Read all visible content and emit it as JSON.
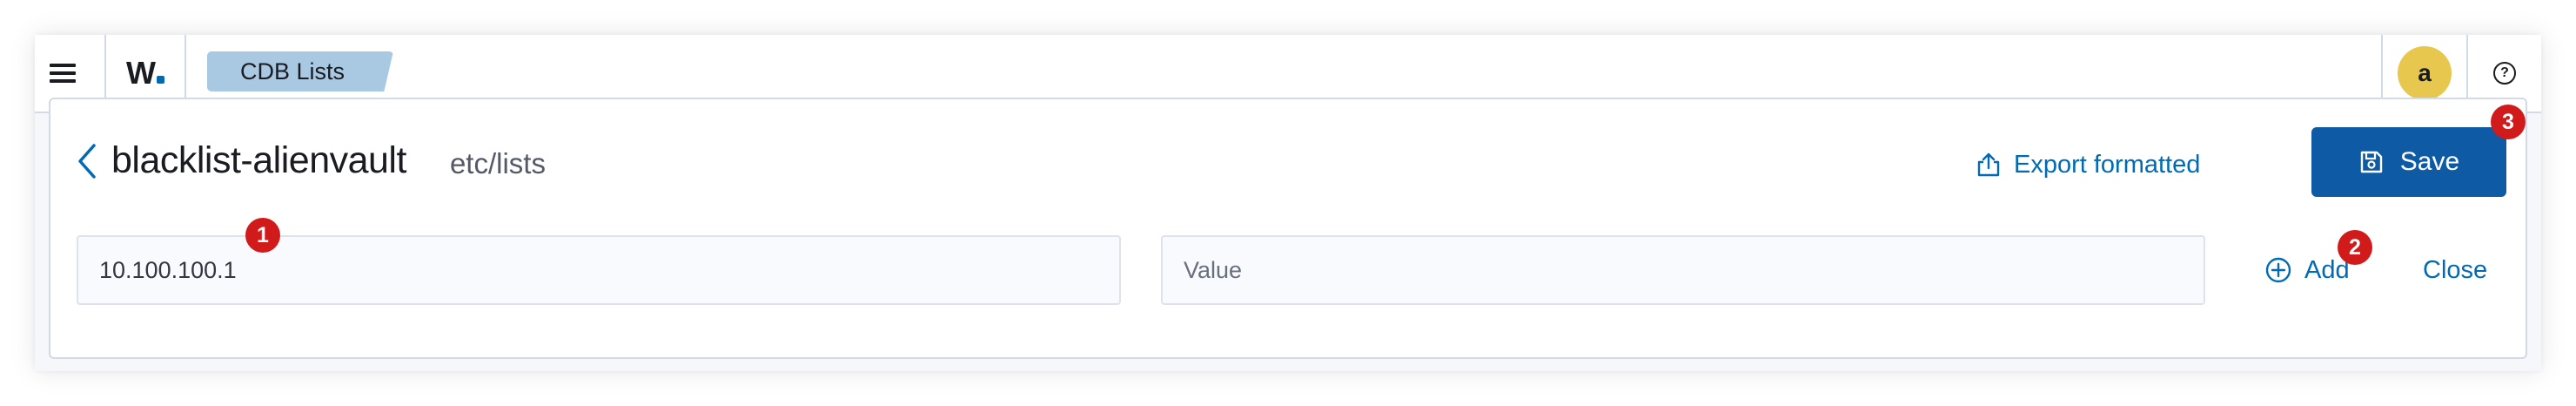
{
  "header": {
    "breadcrumb": "CDB Lists",
    "logo_text": "W",
    "avatar_initial": "a",
    "help_glyph": "?"
  },
  "editor": {
    "title": "blacklist-alienvault",
    "path": "etc/lists",
    "export_label": "Export formatted",
    "save_label": "Save",
    "key_input_value": "10.100.100.1",
    "value_input_placeholder": "Value",
    "add_label": "Add",
    "close_label": "Close"
  },
  "annotations": {
    "badge_1": "1",
    "badge_2": "2",
    "badge_3": "3"
  },
  "colors": {
    "accent": "#006bb4",
    "primary_button": "#0f5aa5",
    "breadcrumb_bg": "#a9c8e2",
    "avatar_bg": "#e7c74e",
    "badge": "#d11a1a"
  },
  "icons": [
    "menu-icon",
    "chevron-left-icon",
    "export-icon",
    "save-icon",
    "plus-circle-icon",
    "help-icon"
  ]
}
